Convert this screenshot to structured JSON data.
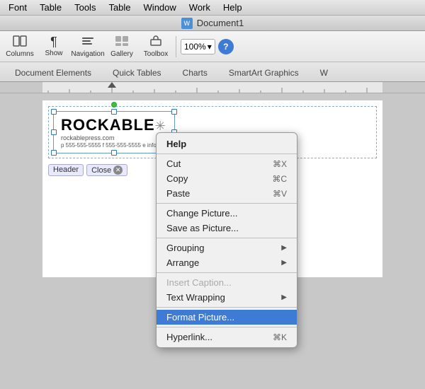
{
  "menubar": {
    "items": [
      {
        "label": "Font",
        "id": "font"
      },
      {
        "label": "Table",
        "id": "table"
      },
      {
        "label": "Tools",
        "id": "tools"
      },
      {
        "label": "Table",
        "id": "table2"
      },
      {
        "label": "Window",
        "id": "window"
      },
      {
        "label": "Work",
        "id": "work"
      },
      {
        "label": "Help",
        "id": "help"
      }
    ]
  },
  "titlebar": {
    "doc_name": "Document1",
    "icon_label": "W"
  },
  "toolbar": {
    "columns_label": "Columns",
    "show_label": "Show",
    "navigation_label": "Navigation",
    "gallery_label": "Gallery",
    "toolbox_label": "Toolbox",
    "zoom_value": "100%",
    "help_label": "?"
  },
  "ribbon": {
    "tabs": [
      {
        "label": "Document Elements",
        "active": false
      },
      {
        "label": "Quick Tables",
        "active": false
      },
      {
        "label": "Charts",
        "active": false
      },
      {
        "label": "SmartArt Graphics",
        "active": false
      },
      {
        "label": "W",
        "active": false
      }
    ]
  },
  "logo": {
    "name": "ROCKABLE",
    "star": "✳",
    "subtitle": "rockablepress.com",
    "contact": "p 555-555-5555  f 555-555-5555  e info@..."
  },
  "header_controls": {
    "header_label": "Header",
    "close_label": "Close"
  },
  "context_menu": {
    "section": "Help",
    "items": [
      {
        "label": "Cut",
        "shortcut": "⌘X",
        "type": "action",
        "arrow": false,
        "disabled": false,
        "highlighted": false
      },
      {
        "label": "Copy",
        "shortcut": "⌘C",
        "type": "action",
        "arrow": false,
        "disabled": false,
        "highlighted": false
      },
      {
        "label": "Paste",
        "shortcut": "⌘V",
        "type": "action",
        "arrow": false,
        "disabled": false,
        "highlighted": false
      },
      {
        "type": "separator"
      },
      {
        "label": "Change Picture...",
        "shortcut": "",
        "type": "action",
        "arrow": false,
        "disabled": false,
        "highlighted": false
      },
      {
        "label": "Save as Picture...",
        "shortcut": "",
        "type": "action",
        "arrow": false,
        "disabled": false,
        "highlighted": false
      },
      {
        "type": "separator"
      },
      {
        "label": "Grouping",
        "shortcut": "",
        "type": "submenu",
        "arrow": true,
        "disabled": false,
        "highlighted": false
      },
      {
        "label": "Arrange",
        "shortcut": "",
        "type": "submenu",
        "arrow": true,
        "disabled": false,
        "highlighted": false
      },
      {
        "type": "separator"
      },
      {
        "label": "Insert Caption...",
        "shortcut": "",
        "type": "action",
        "arrow": false,
        "disabled": true,
        "highlighted": false
      },
      {
        "label": "Text Wrapping",
        "shortcut": "",
        "type": "submenu",
        "arrow": true,
        "disabled": false,
        "highlighted": false
      },
      {
        "type": "separator"
      },
      {
        "label": "Format Picture...",
        "shortcut": "",
        "type": "action",
        "arrow": false,
        "disabled": false,
        "highlighted": true
      },
      {
        "type": "separator"
      },
      {
        "label": "Hyperlink...",
        "shortcut": "⌘K",
        "type": "action",
        "arrow": false,
        "disabled": false,
        "highlighted": false
      }
    ]
  }
}
